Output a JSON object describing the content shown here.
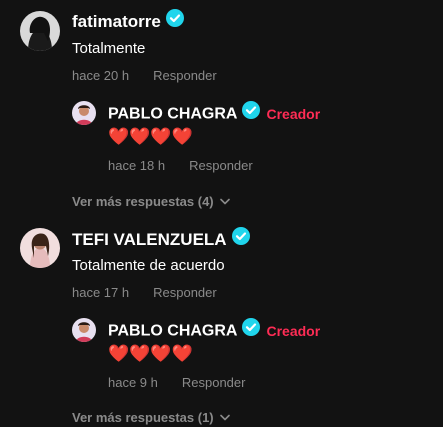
{
  "comments": [
    {
      "username": "fatimatorre",
      "text": "Totalmente",
      "time": "hace 20 h",
      "reply_label": "Responder",
      "reply": {
        "username": "PABLO CHAGRA",
        "creator_badge": "Creador",
        "text": "❤️❤️❤️❤️",
        "time": "hace 18 h",
        "reply_label": "Responder"
      },
      "more_replies": "Ver más respuestas (4)"
    },
    {
      "username": "TEFI VALENZUELA",
      "text": "Totalmente de acuerdo",
      "time": "hace 17 h",
      "reply_label": "Responder",
      "reply": {
        "username": "PABLO CHAGRA",
        "creator_badge": "Creador",
        "text": "❤️❤️❤️❤️",
        "time": "hace 9 h",
        "reply_label": "Responder"
      },
      "more_replies": "Ver más respuestas (1)"
    }
  ],
  "colors": {
    "background": "#121212",
    "verified": "#20d5ec",
    "creator": "#fe2c55",
    "meta": "#8a8a8a"
  }
}
